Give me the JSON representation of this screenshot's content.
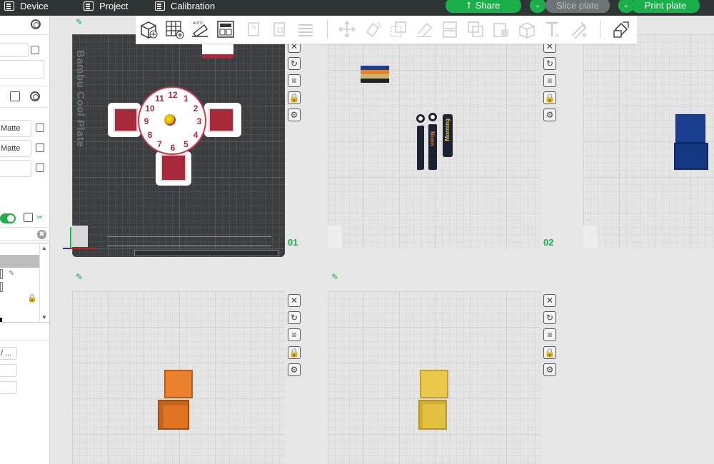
{
  "topbar": {
    "device_label": "Device",
    "project_label": "Project",
    "calibration_label": "Calibration",
    "share_label": "Share",
    "slice_label": "Slice plate",
    "print_label": "Print plate",
    "accent": "#1aaf4b"
  },
  "sidebar": {
    "filament_1": "Matte",
    "filament_2": "Matte",
    "search_clear": "✖",
    "field_value": "/ ..."
  },
  "plates": [
    {
      "number": "01",
      "label": "Bambu Cool Plate"
    },
    {
      "number": "02"
    },
    {
      "number": ""
    },
    {
      "number": ""
    },
    {
      "number": ""
    }
  ],
  "clock": {
    "numbers": [
      "12",
      "1",
      "2",
      "3",
      "4",
      "5",
      "6",
      "7",
      "8",
      "9",
      "10",
      "11"
    ]
  },
  "models": {
    "plate2_text_1": "Noon",
    "plate2_text_2": "Morning"
  },
  "colors": {
    "blue_cube": "#1a3f8f",
    "orange_cube": "#e8802d",
    "yellow_cube": "#e9c84a",
    "clock_red": "#a8293a"
  }
}
